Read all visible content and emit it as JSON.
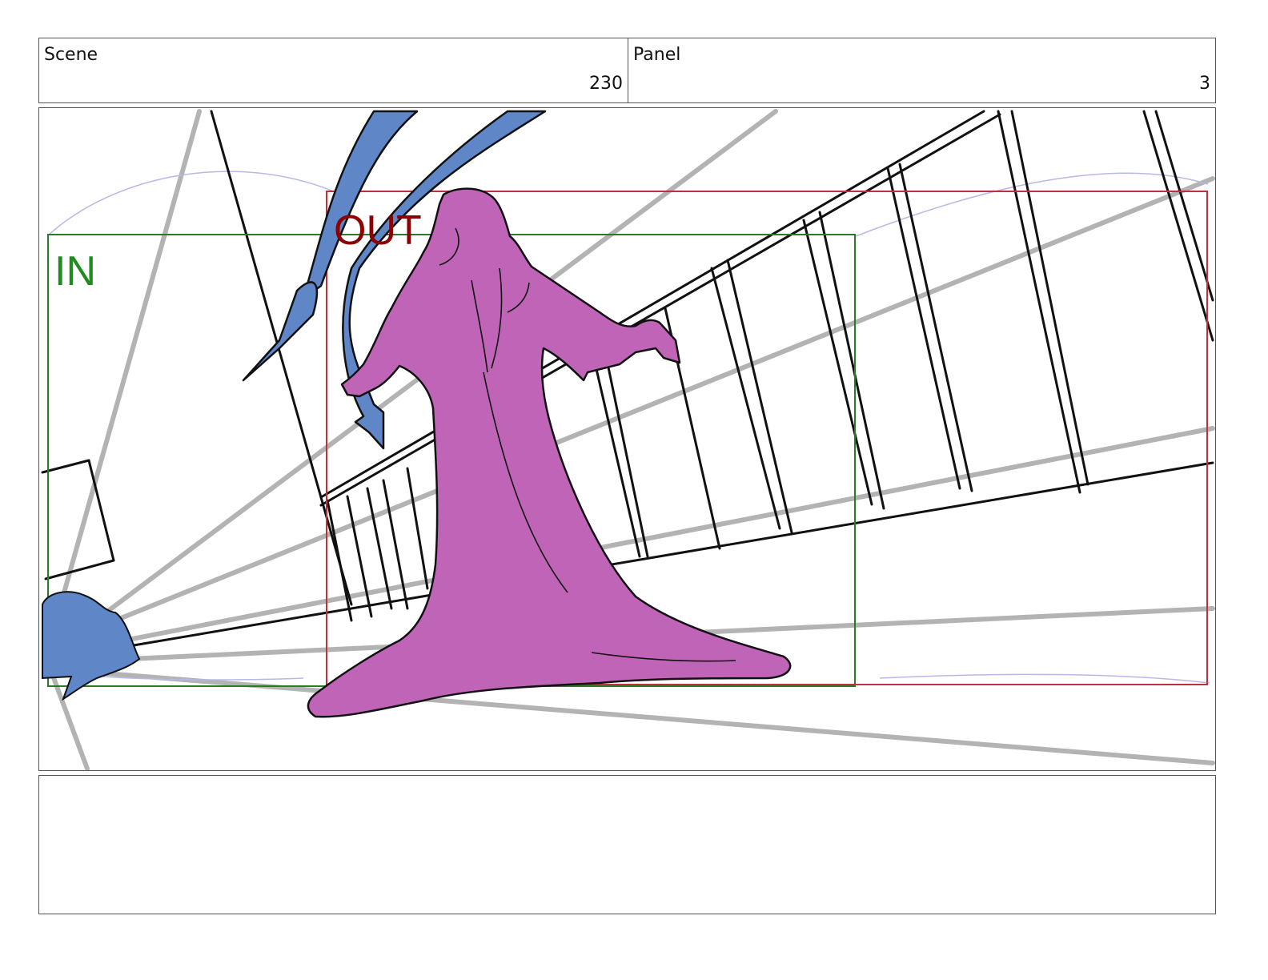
{
  "header": {
    "scene_label": "Scene",
    "scene_value": "230",
    "panel_label": "Panel",
    "panel_value": "3"
  },
  "frame": {
    "in_label": "IN",
    "out_label": "OUT",
    "in_color": "#1e8c1e",
    "in_box_color": "#2a7a2a",
    "out_color": "#8b0000",
    "out_box_color": "#c0303a",
    "figure_color": "#c064b8",
    "accent_color": "#5f86c6",
    "perspective_color": "#b3b3b3"
  },
  "notes": {
    "text": ""
  }
}
